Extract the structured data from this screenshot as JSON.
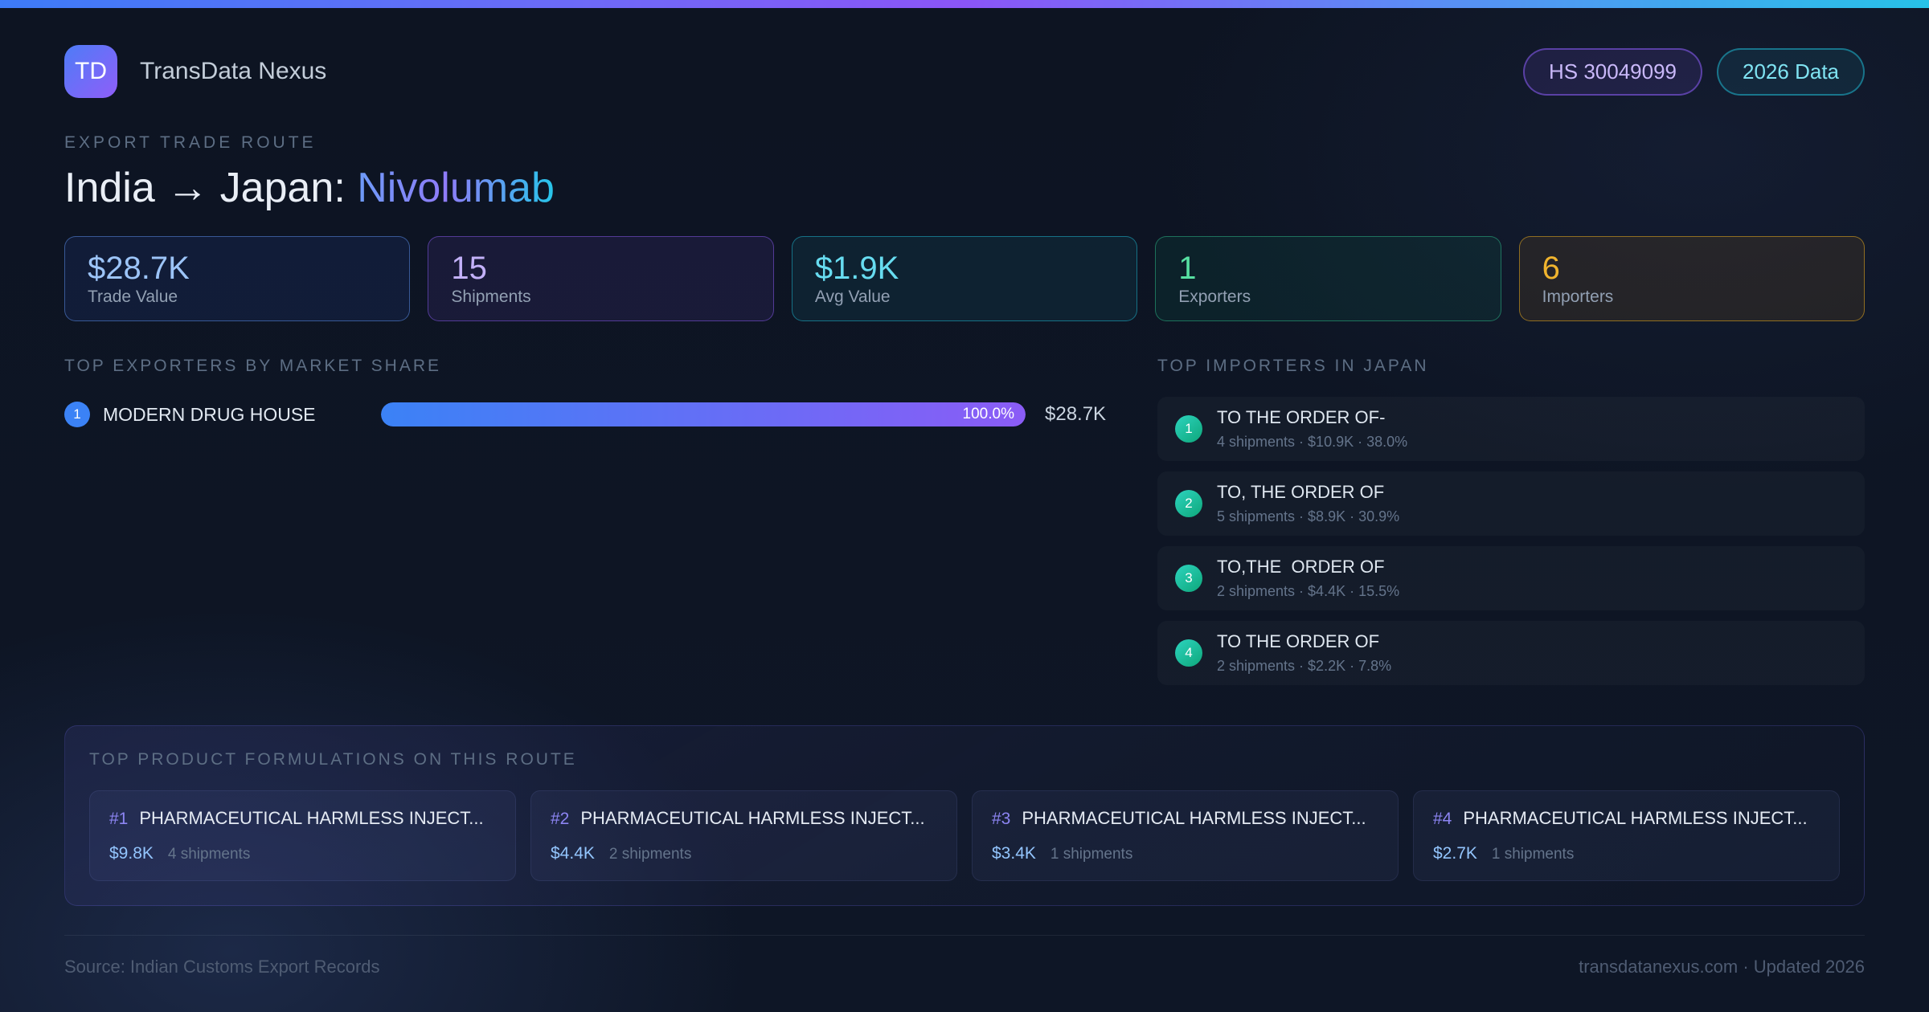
{
  "header": {
    "logo_text": "TD",
    "app_name": "TransData Nexus",
    "badges": [
      {
        "label": "HS 30049099"
      },
      {
        "label": "2026 Data"
      }
    ]
  },
  "hero": {
    "eyebrow": "EXPORT TRADE ROUTE",
    "title_prefix": "India → Japan: ",
    "title_highlight": "Nivolumab"
  },
  "stats": [
    {
      "value": "$28.7K",
      "label": "Trade Value"
    },
    {
      "value": "15",
      "label": "Shipments"
    },
    {
      "value": "$1.9K",
      "label": "Avg Value"
    },
    {
      "value": "1",
      "label": "Exporters"
    },
    {
      "value": "6",
      "label": "Importers"
    }
  ],
  "exporters": {
    "heading": "TOP EXPORTERS BY MARKET SHARE",
    "rows": [
      {
        "rank": "1",
        "name": "MODERN DRUG HOUSE",
        "share_pct": 100.0,
        "share_label": "100.0%",
        "value": "$28.7K"
      }
    ]
  },
  "importers": {
    "heading": "TOP IMPORTERS IN JAPAN",
    "rows": [
      {
        "rank": "1",
        "name": "TO THE ORDER OF-",
        "meta": "4 shipments · $10.9K · 38.0%"
      },
      {
        "rank": "2",
        "name": "TO, THE ORDER OF",
        "meta": "5 shipments · $8.9K · 30.9%"
      },
      {
        "rank": "3",
        "name": "TO,THE  ORDER OF",
        "meta": "2 shipments · $4.4K · 15.5%"
      },
      {
        "rank": "4",
        "name": "TO THE ORDER OF",
        "meta": "2 shipments · $2.2K · 7.8%"
      }
    ]
  },
  "formulations": {
    "heading": "TOP PRODUCT FORMULATIONS ON THIS ROUTE",
    "cards": [
      {
        "rank": "#1",
        "name": "PHARMACEUTICAL HARMLESS INJECT...",
        "value": "$9.8K",
        "shipments": "4 shipments"
      },
      {
        "rank": "#2",
        "name": "PHARMACEUTICAL HARMLESS INJECT...",
        "value": "$4.4K",
        "shipments": "2 shipments"
      },
      {
        "rank": "#3",
        "name": "PHARMACEUTICAL HARMLESS INJECT...",
        "value": "$3.4K",
        "shipments": "1 shipments"
      },
      {
        "rank": "#4",
        "name": "PHARMACEUTICAL HARMLESS INJECT...",
        "value": "$2.7K",
        "shipments": "1 shipments"
      }
    ]
  },
  "footer": {
    "source": "Source: Indian Customs Export Records",
    "site": "transdatanexus.com · Updated 2026"
  },
  "colors": {
    "accent_blue": "#3b82f6",
    "accent_purple": "#8b5cf6",
    "accent_cyan": "#22d3ee",
    "accent_green": "#34d399",
    "accent_amber": "#f59e0b"
  }
}
